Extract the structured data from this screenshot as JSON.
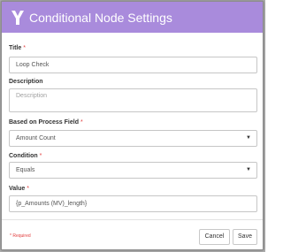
{
  "dialog": {
    "title": "Conditional Node Settings",
    "header_color": "#a98bdc",
    "logo_icon": "fork-logo-icon"
  },
  "fields": {
    "title": {
      "label": "Title",
      "required": "*",
      "value": "Loop Check"
    },
    "description": {
      "label": "Description",
      "placeholder": "Description"
    },
    "process_field": {
      "label": "Based on Process Field",
      "required": "*",
      "value": "Amount Count"
    },
    "condition": {
      "label": "Condition",
      "required": "*",
      "value": "Equals"
    },
    "value": {
      "label": "Value",
      "required": "*",
      "value": "{p_Amounts (MV)_length}"
    }
  },
  "footer": {
    "required_note": "* Required",
    "cancel_label": "Cancel",
    "save_label": "Save"
  }
}
